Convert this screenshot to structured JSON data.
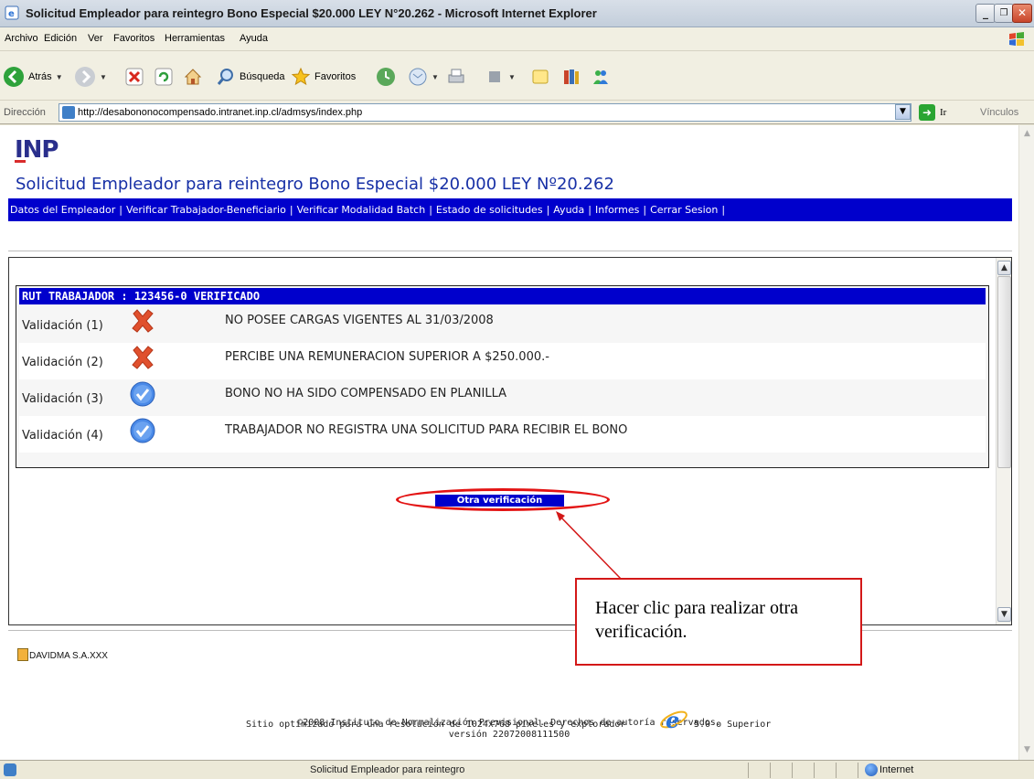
{
  "window": {
    "title": "Solicitud Empleador para reintegro Bono Especial $20.000 LEY N°20.262 - Microsoft Internet Explorer",
    "minimize": "_",
    "maximize": "❐",
    "close": "✕"
  },
  "menu": [
    "Archivo",
    "Edición",
    "Ver",
    "Favoritos",
    "Herramientas",
    "Ayuda"
  ],
  "toolbar": {
    "back_label": "Atrás",
    "search_label": "Búsqueda",
    "favorites_label": "Favoritos"
  },
  "address": {
    "label": "Dirección",
    "url": "http://desabononocompensado.intranet.inp.cl/admsys/index.php",
    "go_label": "Ir",
    "links_label": "Vínculos"
  },
  "page": {
    "logo": "INP",
    "title": "Solicitud Empleador para reintegro Bono Especial $20.000 LEY Nº20.262",
    "nav": [
      "Datos del Empleador",
      "Verificar Trabajador-Beneficiario",
      "Verificar Modalidad Batch",
      "Estado de solicitudes",
      "Ayuda",
      "Informes",
      "Cerrar Sesion"
    ],
    "verification_header": "RUT TRABAJADOR : 123456-0 VERIFICADO",
    "validations": [
      {
        "label": "Validación (1)",
        "status": "fail",
        "text": "NO POSEE CARGAS VIGENTES AL 31/03/2008"
      },
      {
        "label": "Validación (2)",
        "status": "fail",
        "text": "PERCIBE UNA REMUNERACION SUPERIOR A $250.000.-"
      },
      {
        "label": "Validación (3)",
        "status": "ok",
        "text": "BONO NO HA SIDO COMPENSADO EN PLANILLA"
      },
      {
        "label": "Validación (4)",
        "status": "ok",
        "text": "TRABAJADOR NO REGISTRA UNA SOLICITUD PARA RECIBIR EL BONO"
      }
    ],
    "other_button": "Otra verificación",
    "user": "DAVIDMA S.A.XXX",
    "copyright": "©2008 Instituto de Normalización Previsional. Derechos de autoría reservados.",
    "version": "versión 22072008111500",
    "optimized_before": "Sitio optimizado para una resolución de 1024x768 pixeles y explorador",
    "optimized_after": "5.0 o Superior"
  },
  "callout": {
    "text": "Hacer clic para realizar otra verificación."
  },
  "status": {
    "message": "Solicitud Empleador para reintegro",
    "zone": "Internet"
  },
  "colors": {
    "nav_bg": "#0000cc",
    "title_blue": "#1730a6",
    "fail_red": "#e0502d",
    "ok_blue": "#4a8ae8",
    "highlight_red": "#e31313"
  }
}
